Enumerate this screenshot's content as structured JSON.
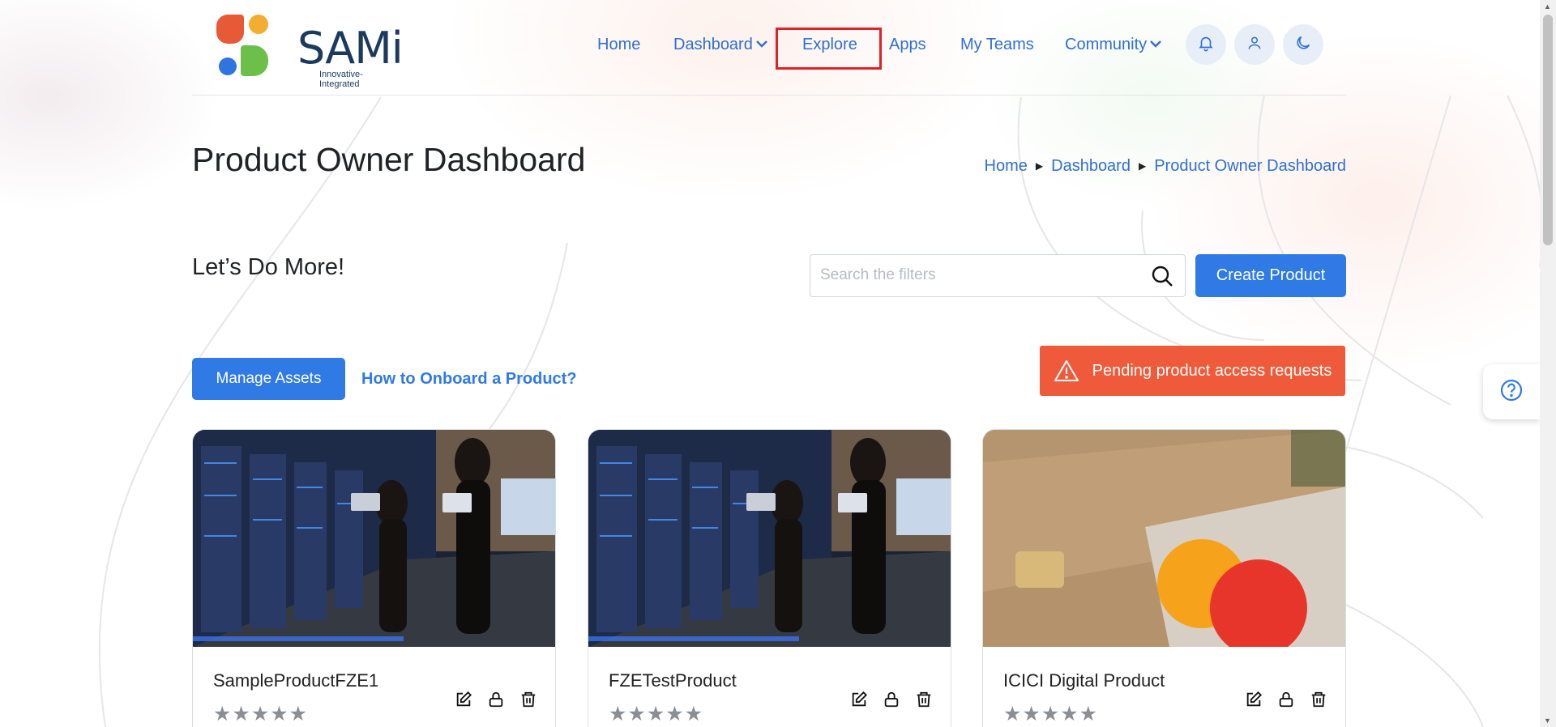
{
  "brand": {
    "name": "SAMi",
    "tagline": "Innovative-Integrated"
  },
  "nav": {
    "home": "Home",
    "dashboard": "Dashboard",
    "explore": "Explore",
    "apps": "Apps",
    "my_teams": "My Teams",
    "community": "Community",
    "icons": [
      "bell-icon",
      "user-icon",
      "moon-icon"
    ]
  },
  "page": {
    "title": "Product Owner Dashboard",
    "subtitle": "Let’s Do More!"
  },
  "breadcrumb": {
    "items": [
      "Home",
      "Dashboard",
      "Product Owner Dashboard"
    ]
  },
  "search": {
    "placeholder": "Search the filters",
    "value": ""
  },
  "buttons": {
    "create_product": "Create Product",
    "manage_assets": "Manage Assets",
    "pending_requests": "Pending product access requests",
    "onboard_link": "How to Onboard a Product?"
  },
  "colors": {
    "primary": "#2f7ae5",
    "danger": "#ee5a3a",
    "highlight": "#e0202a",
    "link": "#2f6fd6"
  },
  "products": [
    {
      "name": "SampleProductFZE1",
      "rating": 0,
      "max_rating": 5,
      "stars": "★★★★★",
      "image": "server-room-photo"
    },
    {
      "name": "FZETestProduct",
      "rating": 0,
      "max_rating": 5,
      "stars": "★★★★★",
      "image": "server-room-photo"
    },
    {
      "name": "ICICI Digital Product",
      "rating": 0,
      "max_rating": 5,
      "stars": "★★★★★",
      "image": "credit-cards-photo"
    }
  ]
}
